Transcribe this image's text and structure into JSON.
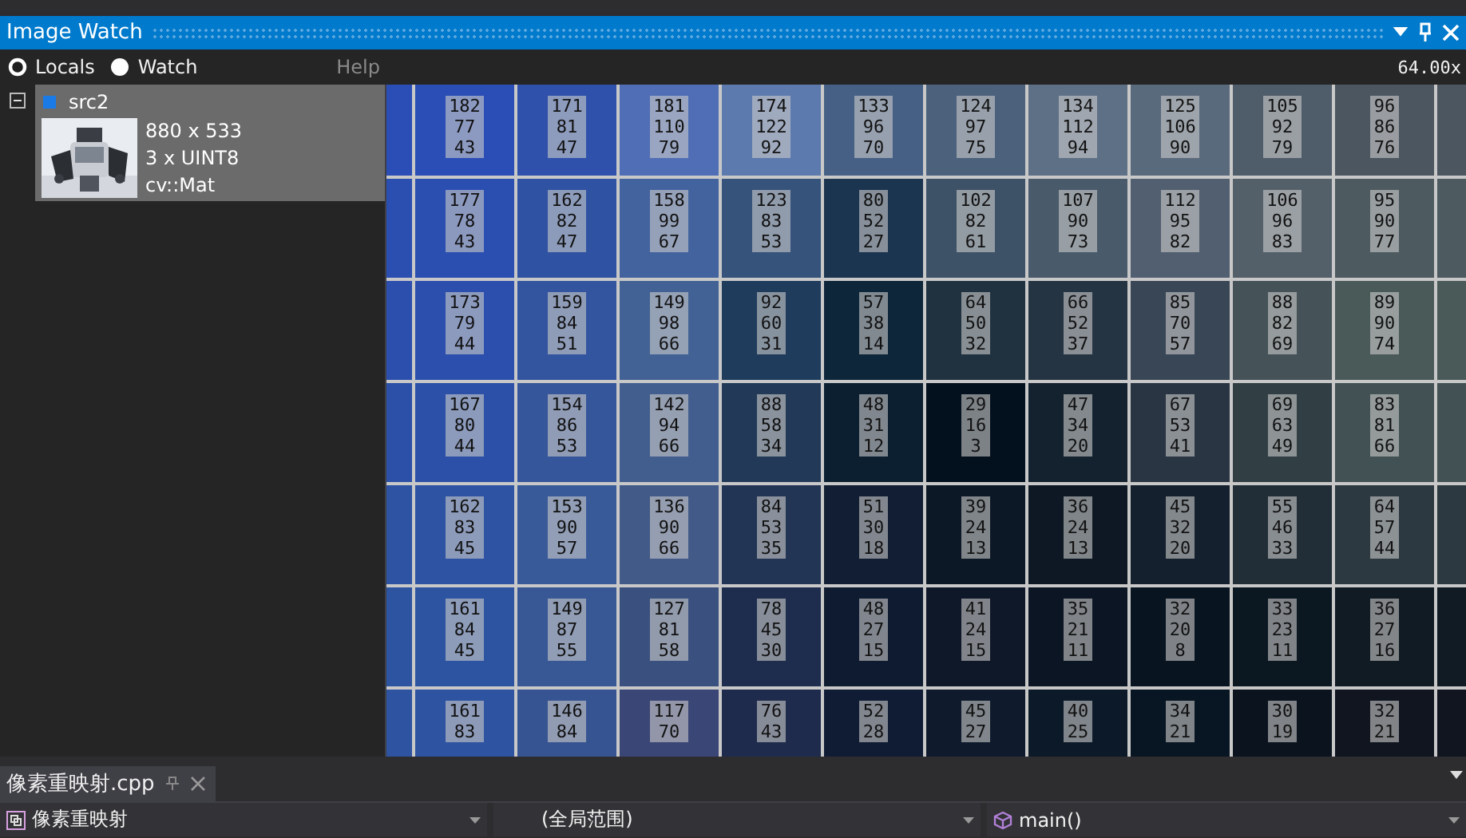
{
  "window": {
    "title": "Image Watch"
  },
  "view_options": [
    {
      "label": "Locals",
      "selected": true
    },
    {
      "label": "Watch",
      "selected": false
    }
  ],
  "help_label": "Help",
  "zoom": "64.00x",
  "variables": [
    {
      "name": "src2",
      "expanded": true,
      "selected": true,
      "details": [
        "880 x 533",
        "3 x UINT8",
        "cv::Mat"
      ]
    }
  ],
  "pixels": {
    "rows": [
      [
        [
          "182",
          "77",
          "43"
        ],
        [
          "171",
          "81",
          "47"
        ],
        [
          "181",
          "110",
          "79"
        ],
        [
          "174",
          "122",
          "92"
        ],
        [
          "133",
          "96",
          "70"
        ],
        [
          "124",
          "97",
          "75"
        ],
        [
          "134",
          "112",
          "94"
        ],
        [
          "125",
          "106",
          "90"
        ],
        [
          "105",
          "92",
          "79"
        ],
        [
          "96",
          "86",
          "76"
        ]
      ],
      [
        [
          "177",
          "78",
          "43"
        ],
        [
          "162",
          "82",
          "47"
        ],
        [
          "158",
          "99",
          "67"
        ],
        [
          "123",
          "83",
          "53"
        ],
        [
          "80",
          "52",
          "27"
        ],
        [
          "102",
          "82",
          "61"
        ],
        [
          "107",
          "90",
          "73"
        ],
        [
          "112",
          "95",
          "82"
        ],
        [
          "106",
          "96",
          "83"
        ],
        [
          "95",
          "90",
          "77"
        ]
      ],
      [
        [
          "173",
          "79",
          "44"
        ],
        [
          "159",
          "84",
          "51"
        ],
        [
          "149",
          "98",
          "66"
        ],
        [
          "92",
          "60",
          "31"
        ],
        [
          "57",
          "38",
          "14"
        ],
        [
          "64",
          "50",
          "32"
        ],
        [
          "66",
          "52",
          "37"
        ],
        [
          "85",
          "70",
          "57"
        ],
        [
          "88",
          "82",
          "69"
        ],
        [
          "89",
          "90",
          "74"
        ]
      ],
      [
        [
          "167",
          "80",
          "44"
        ],
        [
          "154",
          "86",
          "53"
        ],
        [
          "142",
          "94",
          "66"
        ],
        [
          "88",
          "58",
          "34"
        ],
        [
          "48",
          "31",
          "12"
        ],
        [
          "29",
          "16",
          "3"
        ],
        [
          "47",
          "34",
          "20"
        ],
        [
          "67",
          "53",
          "41"
        ],
        [
          "69",
          "63",
          "49"
        ],
        [
          "83",
          "81",
          "66"
        ]
      ],
      [
        [
          "162",
          "83",
          "45"
        ],
        [
          "153",
          "90",
          "57"
        ],
        [
          "136",
          "90",
          "66"
        ],
        [
          "84",
          "53",
          "35"
        ],
        [
          "51",
          "30",
          "18"
        ],
        [
          "39",
          "24",
          "13"
        ],
        [
          "36",
          "24",
          "13"
        ],
        [
          "45",
          "32",
          "20"
        ],
        [
          "55",
          "46",
          "33"
        ],
        [
          "64",
          "57",
          "44"
        ]
      ],
      [
        [
          "161",
          "84",
          "45"
        ],
        [
          "149",
          "87",
          "55"
        ],
        [
          "127",
          "81",
          "58"
        ],
        [
          "78",
          "45",
          "30"
        ],
        [
          "48",
          "27",
          "15"
        ],
        [
          "41",
          "24",
          "15"
        ],
        [
          "35",
          "21",
          "11"
        ],
        [
          "32",
          "20",
          "8"
        ],
        [
          "33",
          "23",
          "11"
        ],
        [
          "36",
          "27",
          "16"
        ]
      ],
      [
        [
          "161",
          "83"
        ],
        [
          "146",
          "84"
        ],
        [
          "117",
          "70"
        ],
        [
          "76",
          "43"
        ],
        [
          "52",
          "28"
        ],
        [
          "45",
          "27"
        ],
        [
          "40",
          "25"
        ],
        [
          "34",
          "21"
        ],
        [
          "30",
          "19"
        ],
        [
          "32",
          "21"
        ]
      ]
    ]
  },
  "editor": {
    "tabs": [
      {
        "label": "像素重映射.cpp",
        "selected": true
      }
    ],
    "project": "像素重映射",
    "scope": "(全局范围)",
    "member": "main()"
  }
}
